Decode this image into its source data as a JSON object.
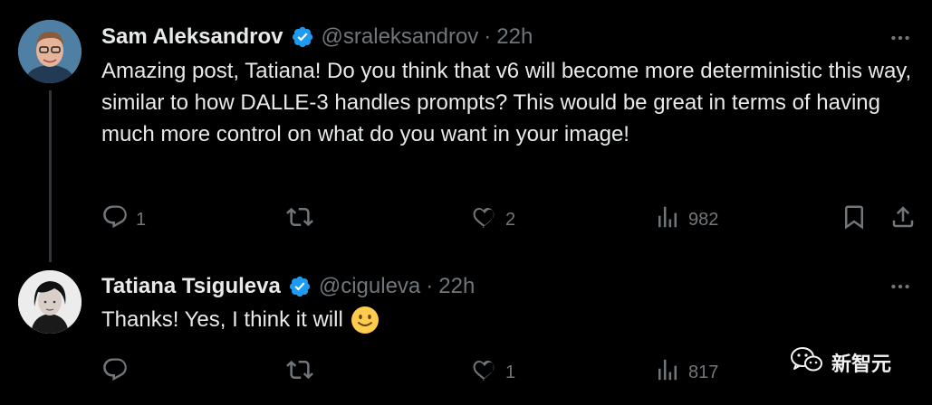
{
  "colors": {
    "background": "#000000",
    "text": "#e7e9ea",
    "muted": "#71767b",
    "verified": "#1d9bf0",
    "thread_line": "#333639"
  },
  "tweets": [
    {
      "author": "Sam Aleksandrov",
      "handle": "@sraleksandrov",
      "time": "22h",
      "separator": "·",
      "text": "Amazing post, Tatiana! Do you think that v6 will become more deterministic this way, similar to how DALLE-3 handles prompts? This would be great in terms of having much more control on what do you want in your image!",
      "replies": "1",
      "retweets": "",
      "likes": "2",
      "views": "982",
      "icons": {
        "verified": "verified-badge-icon",
        "more": "more-dots-icon",
        "reply": "reply-icon",
        "retweet": "retweet-icon",
        "like": "heart-icon",
        "views": "views-chart-icon",
        "bookmark": "bookmark-icon",
        "share": "share-icon"
      }
    },
    {
      "author": "Tatiana Tsiguleva",
      "handle": "@ciguleva",
      "time": "22h",
      "separator": "·",
      "text": "Thanks! Yes, I think it will",
      "emoji": "slightly-smiling-face",
      "replies": "",
      "retweets": "",
      "likes": "1",
      "views": "817"
    }
  ],
  "watermark": {
    "text": "新智元",
    "icon": "wechat-icon"
  }
}
